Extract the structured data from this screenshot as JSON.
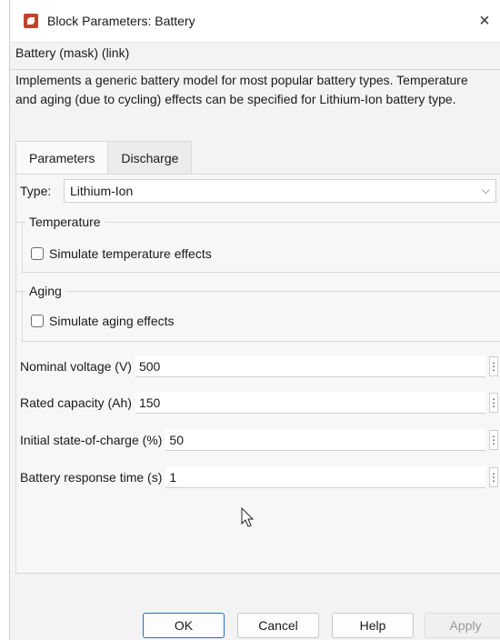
{
  "window": {
    "title": "Block Parameters: Battery",
    "close_glyph": "×",
    "icon": "simulink-block-icon"
  },
  "mask_header": "Battery (mask) (link)",
  "description": "Implements a generic battery model for most popular battery types. Temperature and aging (due to cycling) effects can be specified for Lithium-Ion battery type.",
  "tabs": [
    {
      "label": "Parameters",
      "active": true
    },
    {
      "label": "Discharge",
      "active": false
    }
  ],
  "type": {
    "label": "Type:",
    "value": "Lithium-Ion",
    "chevron": "⌵"
  },
  "temperature_group": {
    "title": "Temperature",
    "checkbox_label": "Simulate temperature effects",
    "checked": false
  },
  "aging_group": {
    "title": "Aging",
    "checkbox_label": "Simulate aging effects",
    "checked": false
  },
  "params": [
    {
      "label": "Nominal voltage (V)",
      "value": "500"
    },
    {
      "label": "Rated capacity (Ah)",
      "value": "150"
    },
    {
      "label": "Initial state-of-charge (%)",
      "value": "50"
    },
    {
      "label": "Battery response time (s)",
      "value": "1"
    }
  ],
  "dots_glyph": "⋮",
  "buttons": {
    "ok": "OK",
    "cancel": "Cancel",
    "help": "Help",
    "apply": "Apply"
  },
  "colors": {
    "accent": "#1f6fd1",
    "icon_red": "#c0442a"
  }
}
